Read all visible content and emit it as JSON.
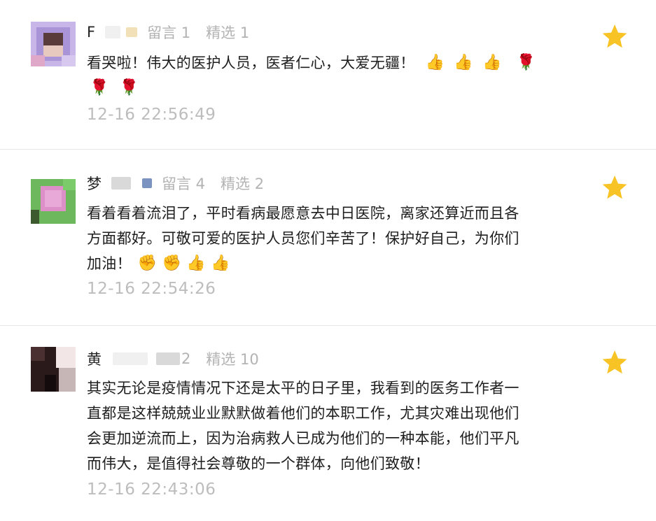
{
  "comments": [
    {
      "nickname": "F",
      "stats": {
        "messages": "留言 1",
        "featured": "精选 1"
      },
      "lines": [
        "看哭啦！伟大的医护人员，医者仁心，大爱无疆！"
      ],
      "emoji_line1": [
        "👍",
        "👍",
        "👍",
        "🌹"
      ],
      "emoji_line2": [
        "🌹",
        "🌹"
      ],
      "timestamp": "12-16 22:56:49",
      "starred": true
    },
    {
      "nickname": "梦",
      "stats": {
        "messages": "留言 4",
        "featured": "精选 2"
      },
      "lines": [
        "看着看着流泪了，平时看病最愿意去中日医院，离家还算近而且各",
        "方面都好。可敬可爱的医护人员您们辛苦了！保护好自己，为你们",
        "加油！"
      ],
      "emoji_line3": [
        "✊",
        "✊",
        "👍",
        "👍"
      ],
      "timestamp": "12-16 22:54:26",
      "starred": true
    },
    {
      "nickname": "黄",
      "stats": {
        "messages": "2",
        "featured": "精选 10"
      },
      "lines": [
        "其实无论是疫情情况下还是太平的日子里，我看到的医务工作者一",
        "直都是这样兢兢业业默默做着他们的本职工作，尤其灾难出现他们",
        "会更加逆流而上，因为治病救人已成为他们的一种本能，他们平凡",
        "而伟大，是值得社会尊敬的一个群体，向他们致敬！"
      ],
      "timestamp": "12-16 22:43:06",
      "starred": true
    }
  ],
  "colors": {
    "star": "#f7c325",
    "timestamp": "#bdbdbd",
    "stats": "#b3b3b3",
    "divider": "#e6e6e6"
  },
  "icons": {
    "favorite": "star-icon"
  }
}
